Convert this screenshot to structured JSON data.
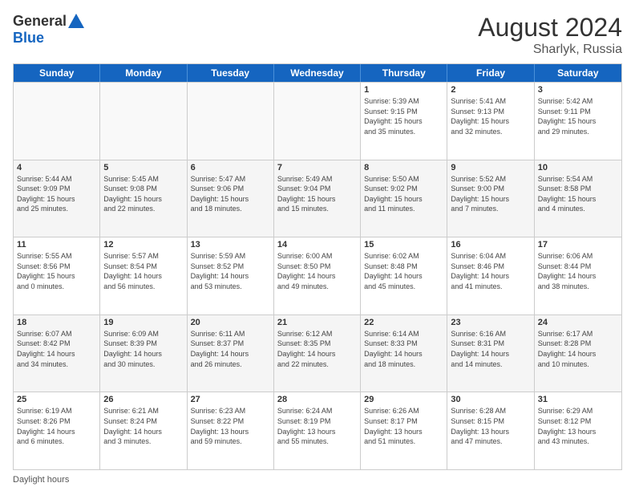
{
  "header": {
    "logo_general": "General",
    "logo_blue": "Blue",
    "title": "August 2024",
    "subtitle": "Sharlyk, Russia"
  },
  "weekdays": [
    "Sunday",
    "Monday",
    "Tuesday",
    "Wednesday",
    "Thursday",
    "Friday",
    "Saturday"
  ],
  "footer": {
    "daylight_label": "Daylight hours"
  },
  "rows": [
    [
      {
        "day": "",
        "info": "",
        "empty": true
      },
      {
        "day": "",
        "info": "",
        "empty": true
      },
      {
        "day": "",
        "info": "",
        "empty": true
      },
      {
        "day": "",
        "info": "",
        "empty": true
      },
      {
        "day": "1",
        "info": "Sunrise: 5:39 AM\nSunset: 9:15 PM\nDaylight: 15 hours\nand 35 minutes."
      },
      {
        "day": "2",
        "info": "Sunrise: 5:41 AM\nSunset: 9:13 PM\nDaylight: 15 hours\nand 32 minutes."
      },
      {
        "day": "3",
        "info": "Sunrise: 5:42 AM\nSunset: 9:11 PM\nDaylight: 15 hours\nand 29 minutes."
      }
    ],
    [
      {
        "day": "4",
        "info": "Sunrise: 5:44 AM\nSunset: 9:09 PM\nDaylight: 15 hours\nand 25 minutes."
      },
      {
        "day": "5",
        "info": "Sunrise: 5:45 AM\nSunset: 9:08 PM\nDaylight: 15 hours\nand 22 minutes."
      },
      {
        "day": "6",
        "info": "Sunrise: 5:47 AM\nSunset: 9:06 PM\nDaylight: 15 hours\nand 18 minutes."
      },
      {
        "day": "7",
        "info": "Sunrise: 5:49 AM\nSunset: 9:04 PM\nDaylight: 15 hours\nand 15 minutes."
      },
      {
        "day": "8",
        "info": "Sunrise: 5:50 AM\nSunset: 9:02 PM\nDaylight: 15 hours\nand 11 minutes."
      },
      {
        "day": "9",
        "info": "Sunrise: 5:52 AM\nSunset: 9:00 PM\nDaylight: 15 hours\nand 7 minutes."
      },
      {
        "day": "10",
        "info": "Sunrise: 5:54 AM\nSunset: 8:58 PM\nDaylight: 15 hours\nand 4 minutes."
      }
    ],
    [
      {
        "day": "11",
        "info": "Sunrise: 5:55 AM\nSunset: 8:56 PM\nDaylight: 15 hours\nand 0 minutes."
      },
      {
        "day": "12",
        "info": "Sunrise: 5:57 AM\nSunset: 8:54 PM\nDaylight: 14 hours\nand 56 minutes."
      },
      {
        "day": "13",
        "info": "Sunrise: 5:59 AM\nSunset: 8:52 PM\nDaylight: 14 hours\nand 53 minutes."
      },
      {
        "day": "14",
        "info": "Sunrise: 6:00 AM\nSunset: 8:50 PM\nDaylight: 14 hours\nand 49 minutes."
      },
      {
        "day": "15",
        "info": "Sunrise: 6:02 AM\nSunset: 8:48 PM\nDaylight: 14 hours\nand 45 minutes."
      },
      {
        "day": "16",
        "info": "Sunrise: 6:04 AM\nSunset: 8:46 PM\nDaylight: 14 hours\nand 41 minutes."
      },
      {
        "day": "17",
        "info": "Sunrise: 6:06 AM\nSunset: 8:44 PM\nDaylight: 14 hours\nand 38 minutes."
      }
    ],
    [
      {
        "day": "18",
        "info": "Sunrise: 6:07 AM\nSunset: 8:42 PM\nDaylight: 14 hours\nand 34 minutes."
      },
      {
        "day": "19",
        "info": "Sunrise: 6:09 AM\nSunset: 8:39 PM\nDaylight: 14 hours\nand 30 minutes."
      },
      {
        "day": "20",
        "info": "Sunrise: 6:11 AM\nSunset: 8:37 PM\nDaylight: 14 hours\nand 26 minutes."
      },
      {
        "day": "21",
        "info": "Sunrise: 6:12 AM\nSunset: 8:35 PM\nDaylight: 14 hours\nand 22 minutes."
      },
      {
        "day": "22",
        "info": "Sunrise: 6:14 AM\nSunset: 8:33 PM\nDaylight: 14 hours\nand 18 minutes."
      },
      {
        "day": "23",
        "info": "Sunrise: 6:16 AM\nSunset: 8:31 PM\nDaylight: 14 hours\nand 14 minutes."
      },
      {
        "day": "24",
        "info": "Sunrise: 6:17 AM\nSunset: 8:28 PM\nDaylight: 14 hours\nand 10 minutes."
      }
    ],
    [
      {
        "day": "25",
        "info": "Sunrise: 6:19 AM\nSunset: 8:26 PM\nDaylight: 14 hours\nand 6 minutes."
      },
      {
        "day": "26",
        "info": "Sunrise: 6:21 AM\nSunset: 8:24 PM\nDaylight: 14 hours\nand 3 minutes."
      },
      {
        "day": "27",
        "info": "Sunrise: 6:23 AM\nSunset: 8:22 PM\nDaylight: 13 hours\nand 59 minutes."
      },
      {
        "day": "28",
        "info": "Sunrise: 6:24 AM\nSunset: 8:19 PM\nDaylight: 13 hours\nand 55 minutes."
      },
      {
        "day": "29",
        "info": "Sunrise: 6:26 AM\nSunset: 8:17 PM\nDaylight: 13 hours\nand 51 minutes."
      },
      {
        "day": "30",
        "info": "Sunrise: 6:28 AM\nSunset: 8:15 PM\nDaylight: 13 hours\nand 47 minutes."
      },
      {
        "day": "31",
        "info": "Sunrise: 6:29 AM\nSunset: 8:12 PM\nDaylight: 13 hours\nand 43 minutes."
      }
    ]
  ]
}
